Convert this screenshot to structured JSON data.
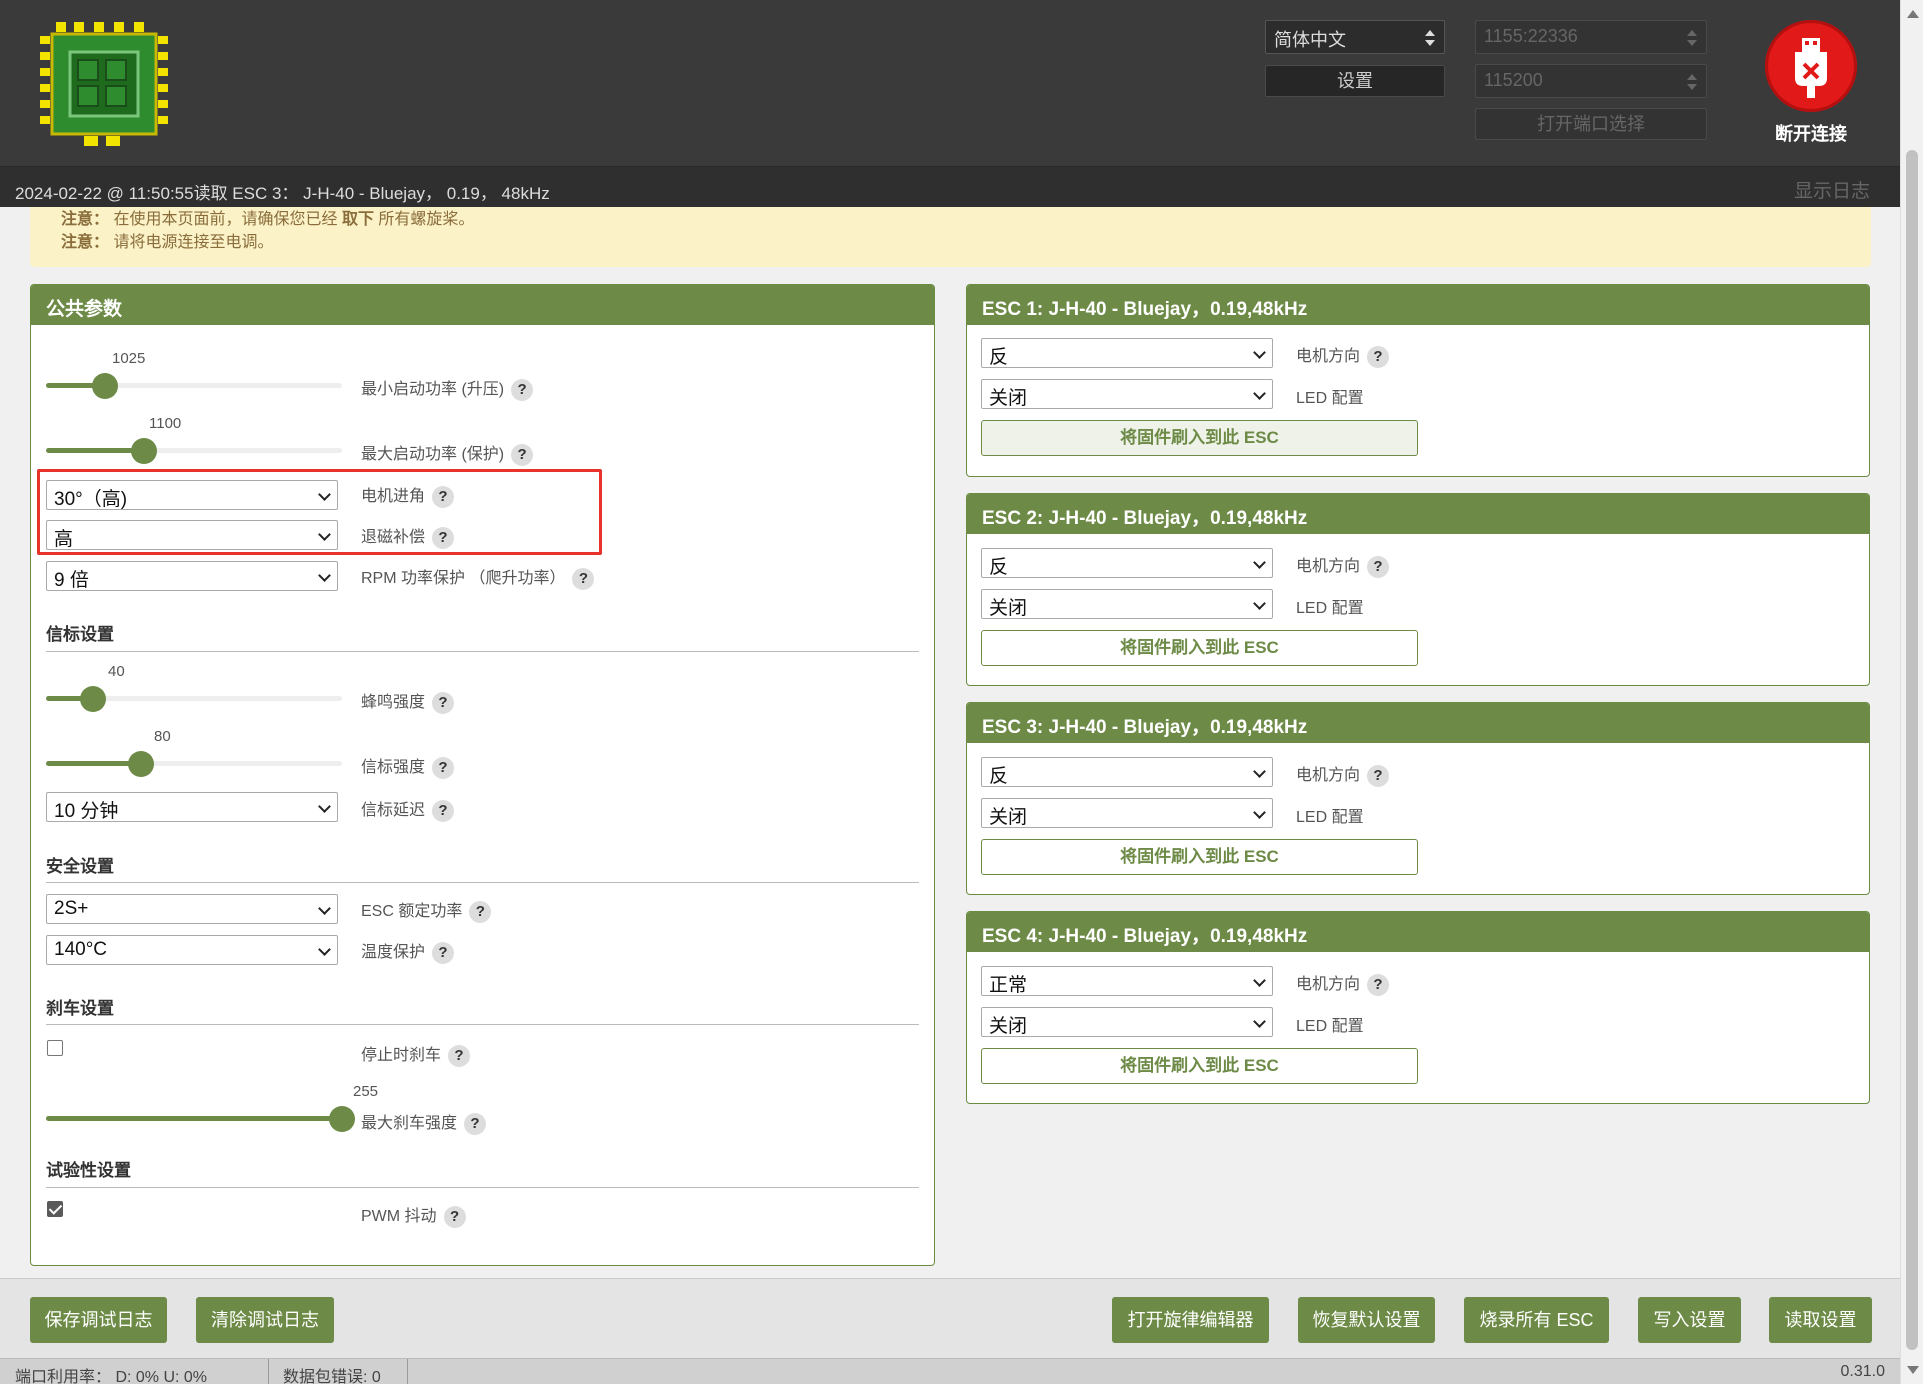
{
  "header": {
    "language": "简体中文",
    "settings_label": "设置",
    "port": "1155:22336",
    "baud": "115200",
    "open_port_label": "打开端口选择",
    "disconnect_label": "断开连接"
  },
  "log": {
    "message": "2024-02-22 @ 11:50:55读取 ESC 3： J-H-40 - Bluejay， 0.19， 48kHz",
    "show_log": "显示日志"
  },
  "notice": {
    "line1_prefix": "注意：",
    "line1_text": "在使用本页面前，请确保您已经",
    "line1_bold": "取下",
    "line1_suffix": "所有螺旋桨。",
    "line2_prefix": "注意：",
    "line2_text": "请将电源连接至电调。"
  },
  "common": {
    "title": "公共参数",
    "min_startup_value": "1025",
    "min_startup_fraction": 0.2,
    "min_startup_label": "最小启动功率 (升压)",
    "max_startup_value": "1100",
    "max_startup_fraction": 0.33,
    "max_startup_label": "最大启动功率 (保护)",
    "motor_timing": "30°（高)",
    "motor_timing_label": "电机进角",
    "demag": "高",
    "demag_label": "退磁补偿",
    "rpm_protect": "9 倍",
    "rpm_protect_label": "RPM 功率保护 （爬升功率）",
    "beacon_section": "信标设置",
    "beep_value": "40",
    "beep_fraction": 0.16,
    "beep_label": "蜂鸣强度",
    "beacon_value": "80",
    "beacon_fraction": 0.32,
    "beacon_label": "信标强度",
    "beacon_delay": "10 分钟",
    "beacon_delay_label": "信标延迟",
    "safety_section": "安全设置",
    "esc_power": "2S+",
    "esc_power_label": "ESC 额定功率",
    "temp_protect": "140°C",
    "temp_protect_label": "温度保护",
    "brake_section": "刹车设置",
    "brake_on_stop_label": "停止时刹车",
    "max_brake_value": "255",
    "max_brake_fraction": 1.0,
    "max_brake_label": "最大刹车强度",
    "experimental_section": "试验性设置",
    "pwm_dither_label": "PWM 抖动",
    "help": "?"
  },
  "escs": [
    {
      "title": "ESC 1:  J-H-40 - Bluejay，0.19,48kHz",
      "direction": "反",
      "led": "关闭"
    },
    {
      "title": "ESC 2:  J-H-40 - Bluejay，0.19,48kHz",
      "direction": "反",
      "led": "关闭"
    },
    {
      "title": "ESC 3:  J-H-40 - Bluejay，0.19,48kHz",
      "direction": "反",
      "led": "关闭"
    },
    {
      "title": "ESC 4:  J-H-40 - Bluejay，0.19,48kHz",
      "direction": "正常",
      "led": "关闭"
    }
  ],
  "esc_labels": {
    "direction_label": "电机方向",
    "led_label": "LED 配置",
    "flash_label": "将固件刷入到此 ESC"
  },
  "toolbar": {
    "save_log": "保存调试日志",
    "clear_log": "清除调试日志",
    "melody": "打开旋律编辑器",
    "restore": "恢复默认设置",
    "flash_all": "烧录所有 ESC",
    "write": "写入设置",
    "read": "读取设置"
  },
  "status": {
    "port_usage": "端口利用率：  D:   0% U:    0%",
    "packet_errors": "数据包错误: 0",
    "version": "0.31.0"
  },
  "colors": {
    "accent": "#6d8b47",
    "header_bg": "#3a3a3a",
    "notice_bg": "#fbf2c8",
    "disconnect": "#e11919",
    "highlight": "#e8322c"
  }
}
